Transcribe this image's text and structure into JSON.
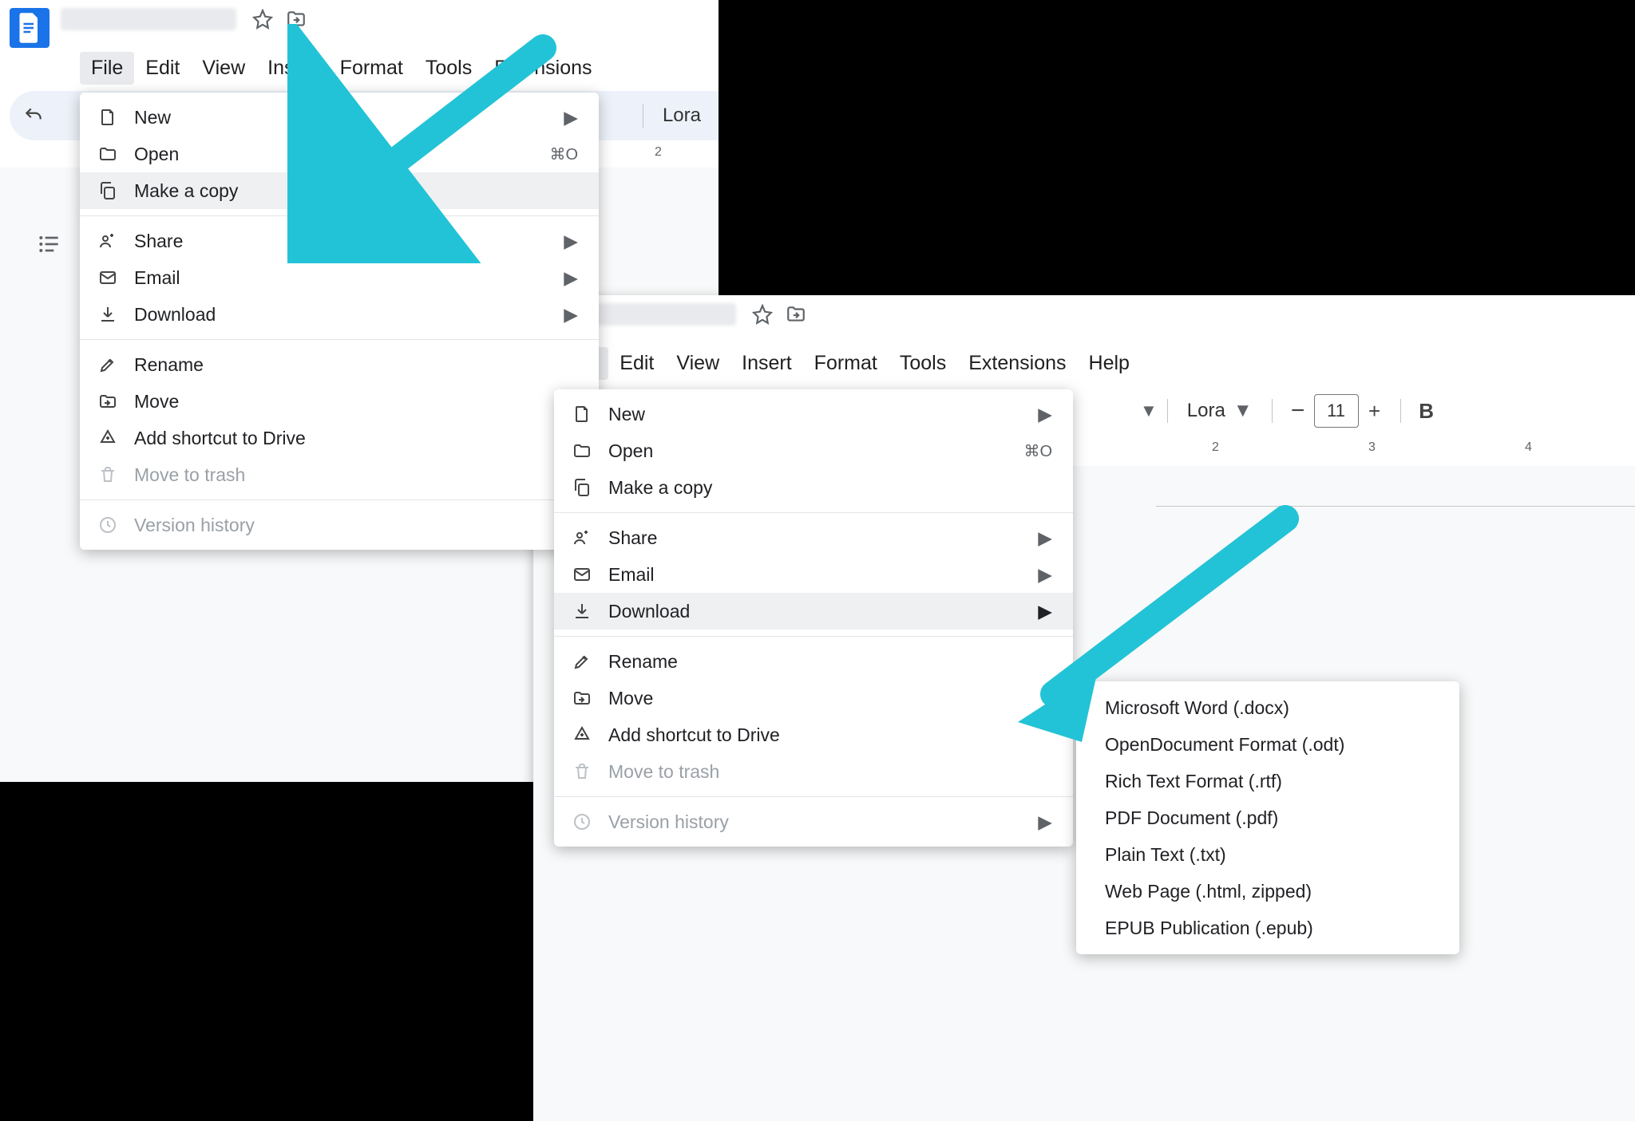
{
  "menus": [
    "File",
    "Edit",
    "View",
    "Insert",
    "Format",
    "Tools",
    "Extensions",
    "Help"
  ],
  "toolbar": {
    "font": "Lora",
    "fontsize": "11"
  },
  "file_menu": {
    "new": "New",
    "open": "Open",
    "open_shortcut": "⌘O",
    "make_copy": "Make a copy",
    "share": "Share",
    "email": "Email",
    "download": "Download",
    "rename": "Rename",
    "move": "Move",
    "add_shortcut": "Add shortcut to Drive",
    "trash": "Move to trash",
    "version_history": "Version history"
  },
  "download_sub": [
    "Microsoft Word (.docx)",
    "OpenDocument Format (.odt)",
    "Rich Text Format (.rtf)",
    "PDF Document (.pdf)",
    "Plain Text (.txt)",
    "Web Page (.html, zipped)",
    "EPUB Publication (.epub)"
  ],
  "ruler": {
    "r1_2": "2",
    "r2_2": "2",
    "r2_3": "3",
    "r2_4": "4"
  }
}
